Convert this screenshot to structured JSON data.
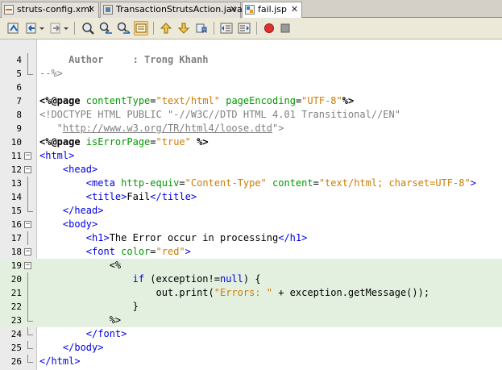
{
  "tabs": [
    {
      "label": "struts-config.xml",
      "icon": "xml-file-icon",
      "active": false
    },
    {
      "label": "TransactionStrutsAction.java",
      "icon": "java-file-icon",
      "active": false
    },
    {
      "label": "fail.jsp",
      "icon": "jsp-file-icon",
      "active": true
    }
  ],
  "toolbar": {
    "buttons": [
      "last-edit-icon",
      "back-icon",
      "forward-icon",
      "find-icon",
      "find-previous-icon",
      "find-next-icon",
      "toggle-highlight-icon",
      "previous-bookmark-icon",
      "next-bookmark-icon",
      "toggle-bookmark-icon",
      "shift-left-icon",
      "shift-right-icon",
      "start-macro-icon",
      "stop-macro-icon"
    ]
  },
  "editor": {
    "lines": [
      {
        "n": "4",
        "parts": [
          [
            "cmtb",
            "     Author     : Trong Khanh"
          ]
        ]
      },
      {
        "n": "5",
        "parts": [
          [
            "cmt",
            "--%>"
          ]
        ]
      },
      {
        "n": "6",
        "parts": []
      },
      {
        "n": "7",
        "parts": [
          [
            "dir",
            "<%@page "
          ],
          [
            "attr",
            "contentType"
          ],
          [
            "",
            "="
          ],
          [
            "str",
            "\"text/html\""
          ],
          [
            "",
            " "
          ],
          [
            "attr",
            "pageEncoding"
          ],
          [
            "",
            "="
          ],
          [
            "str",
            "\"UTF-8\""
          ],
          [
            "dir",
            "%>"
          ]
        ]
      },
      {
        "n": "8",
        "parts": [
          [
            "cmt",
            "<!DOCTYPE HTML PUBLIC \"-//W3C//DTD HTML 4.01 Transitional//EN\""
          ]
        ]
      },
      {
        "n": "9",
        "parts": [
          [
            "cmt",
            "   \""
          ],
          [
            "url",
            "http://www.w3.org/TR/html4/loose.dtd"
          ],
          [
            "cmt",
            "\">"
          ]
        ]
      },
      {
        "n": "10",
        "parts": [
          [
            "dir",
            "<%@page "
          ],
          [
            "attr",
            "isErrorPage"
          ],
          [
            "",
            "="
          ],
          [
            "str",
            "\"true\""
          ],
          [
            "",
            " "
          ],
          [
            "dir",
            "%>"
          ]
        ]
      },
      {
        "n": "11",
        "parts": [
          [
            "tag",
            "<html>"
          ]
        ]
      },
      {
        "n": "12",
        "parts": [
          [
            "",
            "    "
          ],
          [
            "tag",
            "<head>"
          ]
        ]
      },
      {
        "n": "13",
        "parts": [
          [
            "",
            "        "
          ],
          [
            "tag",
            "<meta "
          ],
          [
            "attr",
            "http-equiv"
          ],
          [
            "",
            "="
          ],
          [
            "str",
            "\"Content-Type\""
          ],
          [
            "",
            " "
          ],
          [
            "attr",
            "content"
          ],
          [
            "",
            "="
          ],
          [
            "str",
            "\"text/html; charset=UTF-8\""
          ],
          [
            "tag",
            ">"
          ]
        ]
      },
      {
        "n": "14",
        "parts": [
          [
            "",
            "        "
          ],
          [
            "tag",
            "<title>"
          ],
          [
            "",
            "Fail"
          ],
          [
            "tag",
            "</title>"
          ]
        ]
      },
      {
        "n": "15",
        "parts": [
          [
            "",
            "    "
          ],
          [
            "tag",
            "</head>"
          ]
        ]
      },
      {
        "n": "16",
        "parts": [
          [
            "",
            "    "
          ],
          [
            "tag",
            "<body>"
          ]
        ]
      },
      {
        "n": "17",
        "parts": [
          [
            "",
            "        "
          ],
          [
            "tag",
            "<h1>"
          ],
          [
            "",
            "The Error occur in processing"
          ],
          [
            "tag",
            "</h1>"
          ]
        ]
      },
      {
        "n": "18",
        "parts": [
          [
            "",
            "        "
          ],
          [
            "tag",
            "<font "
          ],
          [
            "attr",
            "color"
          ],
          [
            "",
            "="
          ],
          [
            "str",
            "\"red\""
          ],
          [
            "tag",
            ">"
          ]
        ]
      },
      {
        "n": "19",
        "parts": [
          [
            "",
            "            "
          ],
          [
            "",
            "<%"
          ]
        ]
      },
      {
        "n": "20",
        "parts": [
          [
            "",
            "                "
          ],
          [
            "kw",
            "if"
          ],
          [
            "",
            " (exception!="
          ],
          [
            "kw",
            "null"
          ],
          [
            "",
            ") {"
          ]
        ]
      },
      {
        "n": "21",
        "parts": [
          [
            "",
            "                    out.print("
          ],
          [
            "str",
            "\"Errors: \""
          ],
          [
            "",
            " + exception.getMessage());"
          ]
        ]
      },
      {
        "n": "22",
        "parts": [
          [
            "",
            "                }"
          ]
        ]
      },
      {
        "n": "23",
        "parts": [
          [
            "",
            "            "
          ],
          [
            "",
            "%>"
          ]
        ]
      },
      {
        "n": "24",
        "parts": [
          [
            "",
            "        "
          ],
          [
            "tag",
            "</font>"
          ]
        ]
      },
      {
        "n": "25",
        "parts": [
          [
            "",
            "    "
          ],
          [
            "tag",
            "</body>"
          ]
        ]
      },
      {
        "n": "26",
        "parts": [
          [
            "tag",
            "</html>"
          ]
        ]
      }
    ]
  }
}
